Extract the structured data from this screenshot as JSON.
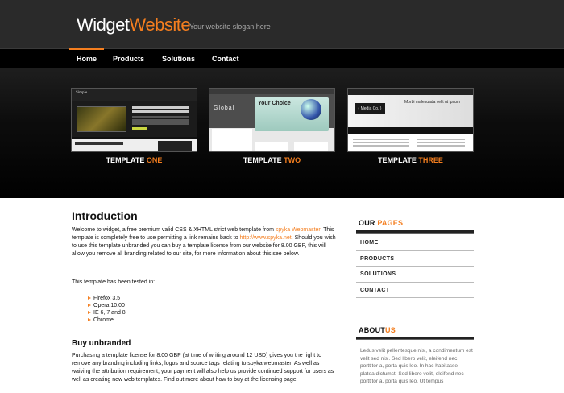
{
  "header": {
    "logo_part1": "Widget",
    "logo_part2": "Website",
    "slogan": "Your website slogan here"
  },
  "nav": {
    "items": [
      "Home",
      "Products",
      "Solutions",
      "Contact"
    ],
    "active": "Home"
  },
  "showcase": {
    "templates": [
      {
        "label": "TEMPLATE",
        "highlight": "ONE",
        "thumb_text": [
          "Simple",
          "Lorem ipsum dolor sit amet, consectetur adipiscing elit.",
          "Welcome to our WEBSITE!"
        ]
      },
      {
        "label": "TEMPLATE",
        "highlight": "TWO",
        "thumb_text": [
          "Global",
          "Your Choice"
        ]
      },
      {
        "label": "TEMPLATE",
        "highlight": "THREE",
        "thumb_text": [
          "( Media Co. )",
          "Morbi malesuada velit ut ipsum"
        ]
      }
    ]
  },
  "main": {
    "title": "Introduction",
    "intro_p1": "Welcome to widget, a free premium valid CSS & XHTML strict web template from ",
    "link1": "spyka Webmaster",
    "intro_p2": ". This template is completely free to use permitting a link remains back to ",
    "link2": "http://www.spyka.net",
    "intro_p3": ". Should you wish to use this template unbranded you can buy a template license from our website for 8.00 GBP, this will allow you remove all branding related to our site, for more information about this see below.",
    "tested_text": "This template has been tested in:",
    "browsers": [
      "Firefox 3.5",
      "Opera 10.00",
      "IE 6, 7 and 8",
      "Chrome"
    ],
    "subtitle": "Buy unbranded",
    "buy_text": "Purchasing a template license for 8.00 GBP (at time of writing around 12 USD) gives you the right to remove any branding including links, logos and source tags relating to spyka webmaster. As well as waiving the attribution requirement, your payment will also help us provide continued support for users as well as creating new web templates. Find out more about how to buy at the licensing page"
  },
  "sidebar": {
    "pages_title_1": "OUR",
    "pages_title_2": "PAGES",
    "pages": [
      "HOME",
      "PRODUCTS",
      "SOLUTIONS",
      "CONTACT"
    ],
    "about_title_1": "ABOUT",
    "about_title_2": "US",
    "about_text": "Ledus velit pellentesque nisl, a condimentum est velit sed nisi. Sed libero velit, eleifend nec porttitor a, porta quis leo. In hac habitasse platea dictumst. Sed libero velit, eleifend nec porttitor a, porta quis leo. Ut tempus"
  },
  "colors": {
    "accent": "#f47e1f",
    "header_bg": "#2a2a2a",
    "nav_bg": "#000000"
  }
}
